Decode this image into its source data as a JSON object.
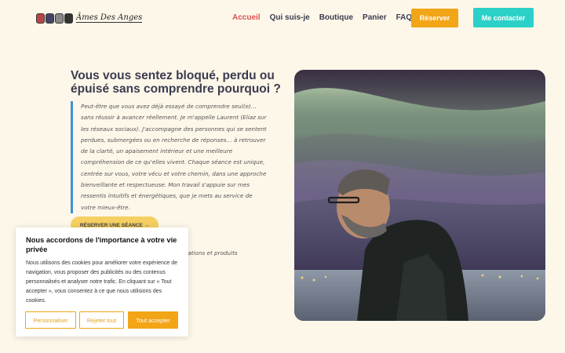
{
  "header": {
    "logo_text": "Âmes Des Anges",
    "nav": [
      {
        "label": "Accueil",
        "active": true
      },
      {
        "label": "Qui suis-je",
        "active": false
      },
      {
        "label": "Boutique",
        "active": false
      },
      {
        "label": "Panier",
        "active": false
      },
      {
        "label": "FAQ",
        "active": false
      }
    ],
    "reserve_label": "Réserver",
    "contact_label": "Me contacter"
  },
  "hero": {
    "title": "Vous vous sentez bloqué, perdu ou épuisé sans comprendre pourquoi ?",
    "quote": "Peut-être que vous avez déjà essayé de comprendre seul(e)… sans réussir à avancer réellement. Je m'appelle Laurent (Eliaz sur les réseaux sociaux). J'accompagne des personnes qui se sentent perdues, submergées ou en recherche de réponses… à retrouver de la clarté, un apaisement intérieur et une meilleure compréhension de ce qu'elles vivent. Chaque séance est unique, centrée sur vous, votre vécu et votre chemin, dans une approche bienveillante et respectueuse. Mon travail s'appuie sur mes ressentis intuitifs et énergétiques, que je mets au service de votre mieux-être.",
    "cta_label": "RÉSERVER UNE SÉANCE →",
    "secondary_text": "créations et produits"
  },
  "cookie": {
    "title": "Nous accordons de l'importance à votre vie privée",
    "text": "Nous utilisons des cookies pour améliorer votre expérience de navigation, vous proposer des publicités ou des contenus personnalisés et analyser notre trafic. En cliquant sur « Tout accepter », vous consentez à ce que nous utilisions des cookies.",
    "customize_label": "Personnaliser",
    "reject_label": "Rejeter tout",
    "accept_label": "Tout accepter"
  },
  "colors": {
    "background": "#fdf7e9",
    "accent_orange": "#f2a516",
    "accent_teal": "#2bd1c8",
    "nav_active": "#d9534f",
    "quote_border": "#3c93d6"
  }
}
